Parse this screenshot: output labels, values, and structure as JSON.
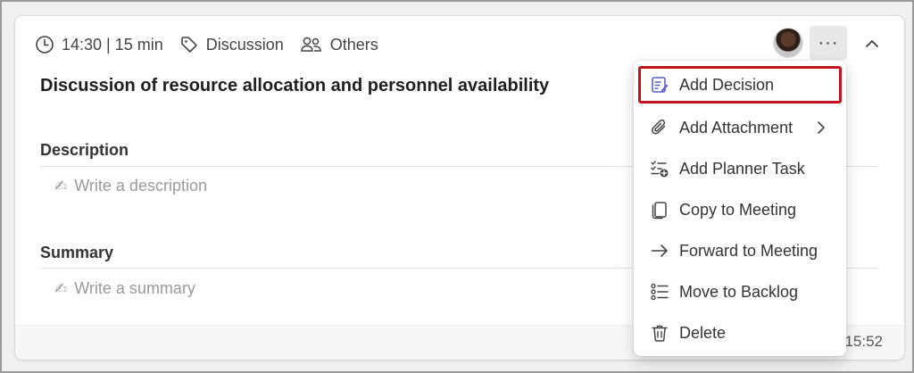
{
  "meta": {
    "time": "14:30 | 15 min",
    "type": "Discussion",
    "attendees": "Others"
  },
  "item": {
    "title": "Discussion of resource allocation and personnel availability"
  },
  "description": {
    "label": "Description",
    "placeholder": "Write a description",
    "pen_glyph": "✍"
  },
  "summary": {
    "label": "Summary",
    "placeholder": "Write a summary",
    "pen_glyph": "✍"
  },
  "footer": {
    "text": "er 15:52"
  },
  "more_button": {
    "glyph": "···"
  },
  "menu": {
    "items": [
      {
        "label": "Add Decision",
        "icon": "decision-icon",
        "highlighted": true
      },
      {
        "label": "Add Attachment",
        "icon": "paperclip-icon",
        "has_submenu": true
      },
      {
        "label": "Add Planner Task",
        "icon": "planner-task-icon"
      },
      {
        "label": "Copy to Meeting",
        "icon": "copy-icon"
      },
      {
        "label": "Forward to Meeting",
        "icon": "arrow-right-icon"
      },
      {
        "label": "Move to Backlog",
        "icon": "list-icon"
      },
      {
        "label": "Delete",
        "icon": "trash-icon"
      }
    ]
  },
  "colors": {
    "accent": "#5b5fc7",
    "highlight_border": "#c1121f"
  }
}
